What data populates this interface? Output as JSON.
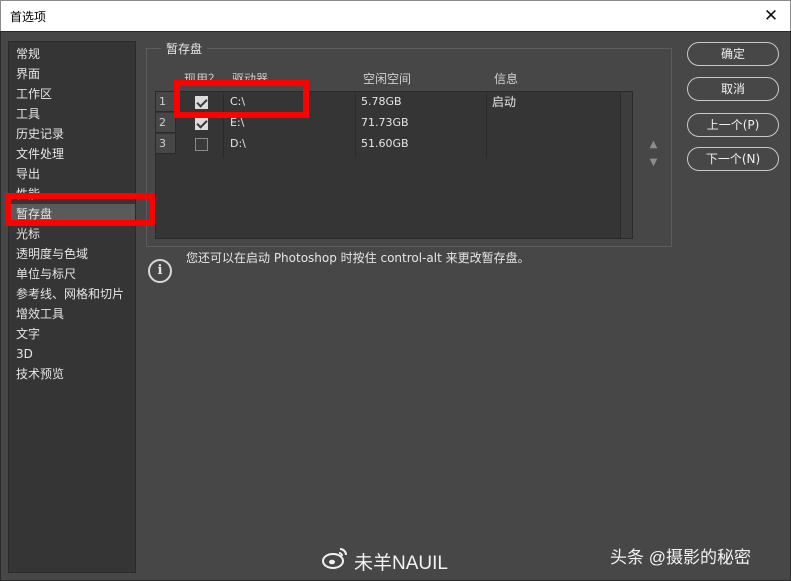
{
  "window": {
    "title": "首选项",
    "close_glyph": "✕"
  },
  "nav": {
    "items": [
      {
        "label": "常规",
        "selected": false
      },
      {
        "label": "界面",
        "selected": false
      },
      {
        "label": "工作区",
        "selected": false
      },
      {
        "label": "工具",
        "selected": false
      },
      {
        "label": "历史记录",
        "selected": false
      },
      {
        "label": "文件处理",
        "selected": false
      },
      {
        "label": "导出",
        "selected": false
      },
      {
        "label": "性能",
        "selected": false
      },
      {
        "label": "暂存盘",
        "selected": true
      },
      {
        "label": "光标",
        "selected": false
      },
      {
        "label": "透明度与色域",
        "selected": false
      },
      {
        "label": "单位与标尺",
        "selected": false
      },
      {
        "label": "参考线、网格和切片",
        "selected": false
      },
      {
        "label": "增效工具",
        "selected": false
      },
      {
        "label": "文字",
        "selected": false
      },
      {
        "label": "3D",
        "selected": false
      },
      {
        "label": "技术预览",
        "selected": false
      }
    ]
  },
  "scratch": {
    "group_label": "暂存盘",
    "columns": {
      "active": "现用？",
      "drive": "驱动器",
      "free": "空闲空间",
      "info": "信息"
    },
    "rows": [
      {
        "num": "1",
        "checked": true,
        "drive": "C:\\",
        "free": "5.78GB",
        "info": "启动"
      },
      {
        "num": "2",
        "checked": true,
        "drive": "E:\\",
        "free": "71.73GB",
        "info": ""
      },
      {
        "num": "3",
        "checked": false,
        "drive": "D:\\",
        "free": "51.60GB",
        "info": ""
      }
    ]
  },
  "info": {
    "text": "您还可以在启动 Photoshop 时按住 control-alt 来更改暂存盘。"
  },
  "buttons": {
    "ok": "确定",
    "cancel": "取消",
    "prev": "上一个(P)",
    "next": "下一个(N)"
  },
  "watermarks": {
    "weibo": "未羊NAUIL",
    "toutiao": "头条 @摄影的秘密"
  },
  "colors": {
    "highlight": "#ff0000",
    "panel": "#474747",
    "list_bg": "#353535"
  }
}
